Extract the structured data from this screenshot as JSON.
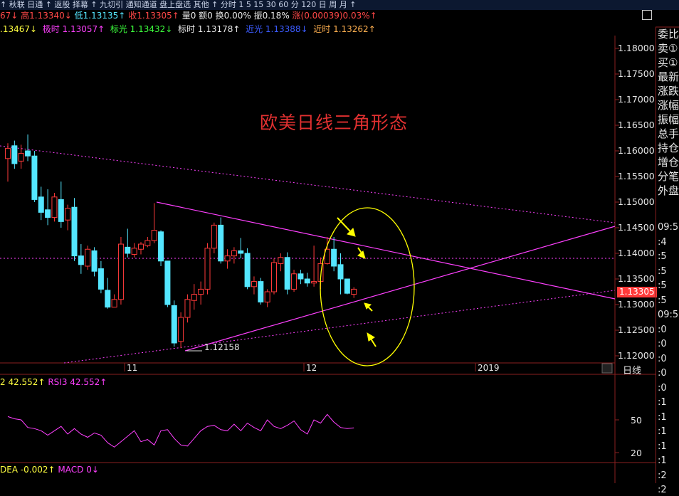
{
  "topbar": {
    "text": "↑ 秋联 日通 ↑ 返股 择幕 ↑ 九切引 通知通道 盘上盘选 其他 ↑ 分时 1 5 15 30 60 分 120 日 周 月 ↑"
  },
  "quote_line1": {
    "open": "67↓",
    "high": "高1.13340↓",
    "low": "低1.13135↑",
    "close": "收1.13305↑",
    "volume": "量0",
    "amount": "额0",
    "turnover": "换0.00%",
    "amplitude": "振0.18%",
    "change": "涨(0.00039)0.03%↑"
  },
  "quote_line2": {
    "v1": ".13467↓",
    "jishi": "极时 1.13057↑",
    "biaoguang": "标光 1.13432↓",
    "biaoshi": "标时 1.13178↑",
    "jinguang": "近光 1.13388↓",
    "jinshi": "近时 1.13262↑"
  },
  "title": "欧美日线三角形态",
  "price_axis": [
    "1.18000",
    "1.17500",
    "1.17000",
    "1.16500",
    "1.16000",
    "1.15500",
    "1.15000",
    "1.14500",
    "1.14000",
    "1.13500",
    "1.13000",
    "1.12500",
    "1.12000"
  ],
  "current_price": "1.13305",
  "low_annotation": "1.12158",
  "x_axis": [
    "11",
    "12",
    "2019"
  ],
  "period": "日线",
  "right_panel": {
    "labels": [
      "委比",
      "卖①",
      "买①",
      "最新",
      "涨跌",
      "涨幅",
      "振幅",
      "总手",
      "持仓",
      "增仓",
      "分笔",
      "外盘"
    ],
    "times": [
      "09:5",
      ":4",
      ":5",
      ":5",
      ":5",
      ":5",
      "09:5",
      ":0",
      ":0",
      ":0",
      ":0",
      ":0",
      ":1",
      ":1",
      ":1",
      ":1",
      ":1",
      ":2",
      ":2"
    ]
  },
  "rsi": {
    "label_prev": "2 42.552↑",
    "label_rsi3": "RSI3 42.552↑",
    "axis": [
      "50",
      "20"
    ]
  },
  "macd": {
    "dea": "DEA -0.002↑",
    "macd": "MACD 0↓"
  },
  "colors": {
    "up": "#ff3a3a",
    "down": "#54e6ff",
    "trendline": "#ff40ff",
    "ellipse": "#ffff00",
    "arrow": "#ffff00",
    "title": "#e03030"
  },
  "chart_data": {
    "type": "candlestick",
    "title": "欧美日线三角形态",
    "ylim": [
      1.12,
      1.18
    ],
    "candles": [
      [
        1.1585,
        1.1615,
        1.154,
        1.1605
      ],
      [
        1.161,
        1.162,
        1.1565,
        1.1575
      ],
      [
        1.158,
        1.1612,
        1.1565,
        1.1595
      ],
      [
        1.16,
        1.1632,
        1.158,
        1.159
      ],
      [
        1.159,
        1.16,
        1.15,
        1.1505
      ],
      [
        1.151,
        1.153,
        1.1465,
        1.148
      ],
      [
        1.1485,
        1.1525,
        1.1455,
        1.147
      ],
      [
        1.147,
        1.1518,
        1.1462,
        1.151
      ],
      [
        1.1505,
        1.154,
        1.145,
        1.1462
      ],
      [
        1.1465,
        1.1495,
        1.1445,
        1.1488
      ],
      [
        1.149,
        1.1508,
        1.1385,
        1.1395
      ],
      [
        1.1395,
        1.1418,
        1.136,
        1.1378
      ],
      [
        1.1375,
        1.1415,
        1.1368,
        1.1408
      ],
      [
        1.1405,
        1.1412,
        1.1355,
        1.1365
      ],
      [
        1.137,
        1.1385,
        1.1322,
        1.133
      ],
      [
        1.1328,
        1.1352,
        1.1292,
        1.1295
      ],
      [
        1.1295,
        1.132,
        1.13,
        1.131
      ],
      [
        1.131,
        1.1432,
        1.13,
        1.1418
      ],
      [
        1.1412,
        1.1448,
        1.1392,
        1.14
      ],
      [
        1.1398,
        1.142,
        1.1392,
        1.141
      ],
      [
        1.1408,
        1.1422,
        1.1398,
        1.1418
      ],
      [
        1.1415,
        1.1432,
        1.1412,
        1.1425
      ],
      [
        1.1425,
        1.1498,
        1.142,
        1.1445
      ],
      [
        1.1442,
        1.1445,
        1.1375,
        1.1385
      ],
      [
        1.1385,
        1.134,
        1.1295,
        1.13
      ],
      [
        1.1298,
        1.1308,
        1.1218,
        1.1225
      ],
      [
        1.1228,
        1.1285,
        1.1215,
        1.1275
      ],
      [
        1.1275,
        1.132,
        1.1265,
        1.131
      ],
      [
        1.1308,
        1.134,
        1.129,
        1.132
      ],
      [
        1.132,
        1.1345,
        1.13,
        1.133
      ],
      [
        1.133,
        1.142,
        1.132,
        1.141
      ],
      [
        1.141,
        1.146,
        1.14,
        1.1455
      ],
      [
        1.1455,
        1.147,
        1.138,
        1.1385
      ],
      [
        1.1385,
        1.1408,
        1.137,
        1.1395
      ],
      [
        1.1395,
        1.1412,
        1.138,
        1.1405
      ],
      [
        1.1405,
        1.143,
        1.139,
        1.14
      ],
      [
        1.14,
        1.141,
        1.133,
        1.1335
      ],
      [
        1.1335,
        1.1355,
        1.132,
        1.1345
      ],
      [
        1.1345,
        1.1352,
        1.13,
        1.1305
      ],
      [
        1.1305,
        1.133,
        1.1295,
        1.1325
      ],
      [
        1.1325,
        1.139,
        1.132,
        1.1382
      ],
      [
        1.138,
        1.14,
        1.1365,
        1.1392
      ],
      [
        1.1392,
        1.1402,
        1.132,
        1.133
      ],
      [
        1.133,
        1.1368,
        1.1325,
        1.136
      ],
      [
        1.136,
        1.1368,
        1.134,
        1.135
      ],
      [
        1.135,
        1.1362,
        1.1335,
        1.1342
      ],
      [
        1.1342,
        1.1415,
        1.1335,
        1.1345
      ],
      [
        1.1345,
        1.1392,
        1.133,
        1.138
      ],
      [
        1.138,
        1.1432,
        1.1378,
        1.1408
      ],
      [
        1.1408,
        1.1432,
        1.1365,
        1.1375
      ],
      [
        1.1378,
        1.14,
        1.132,
        1.135
      ],
      [
        1.135,
        1.135,
        1.132,
        1.1322
      ],
      [
        1.132,
        1.1334,
        1.1313,
        1.133
      ]
    ],
    "x_labels": [
      {
        "index": 23,
        "label": "11"
      },
      {
        "index": 46,
        "label": "12"
      }
    ],
    "rsi_values": [
      53,
      51,
      50,
      43,
      42,
      40,
      36,
      40,
      44,
      37,
      42,
      37,
      34,
      38,
      36,
      29,
      25,
      30,
      35,
      40,
      30,
      32,
      27,
      40,
      41,
      33,
      27,
      26,
      33,
      40,
      44,
      45,
      41,
      40,
      46,
      40,
      47,
      43,
      40,
      50,
      44,
      42,
      45,
      49,
      41,
      37,
      50,
      47,
      55,
      48,
      43,
      42,
      42.6
    ]
  }
}
